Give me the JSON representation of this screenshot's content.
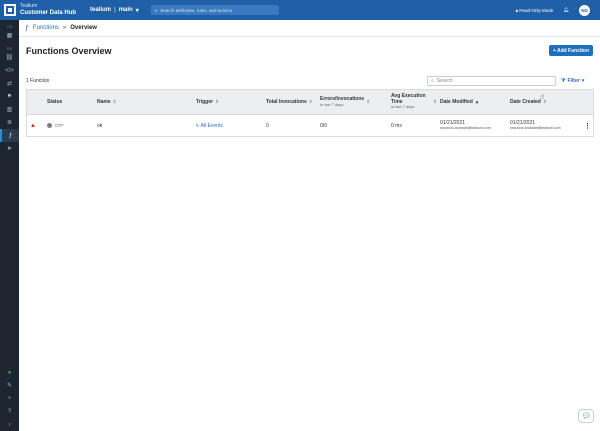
{
  "topbar": {
    "brand_sub": "Tealium",
    "brand_title": "Customer Data Hub",
    "account": "tealium",
    "profile": "main",
    "search_placeholder": "Search attributes, rules, and actions",
    "readonly_label": "Read-Only Mode",
    "avatar_initials": "ND"
  },
  "rail": {
    "section_cs": "CS",
    "section_ss": "SS"
  },
  "breadcrumb": {
    "parent": "Functions",
    "current": "Overview"
  },
  "page": {
    "title": "Functions Overview",
    "add_button": "+ Add Function",
    "count_label": "1 Function",
    "search_placeholder": "Search",
    "filter_label": "Filter"
  },
  "table": {
    "headers": {
      "status": "Status",
      "name": "Name",
      "trigger": "Trigger",
      "total": "Total Invocations",
      "errors": "Errors/Invocations",
      "errors_sub": "in last 7 days",
      "avg": "Avg Execution Time",
      "avg_sub": "in last 7 days",
      "date_modified": "Date Modified",
      "date_created": "Date Created"
    },
    "rows": [
      {
        "status": "OFF",
        "name": "ok",
        "trigger": "All Events",
        "total": "0",
        "errors": "0/0",
        "avg": "0 ms",
        "date_modified": "01/21/2021",
        "modified_by": "mauricio.andrade@tealium.com",
        "date_created": "01/21/2021",
        "created_by": "mauricio.andrade@tealium.com"
      }
    ]
  },
  "colors": {
    "topbar": "#1f5fa8",
    "rail": "#1d2530",
    "accent": "#1f6fc0"
  }
}
